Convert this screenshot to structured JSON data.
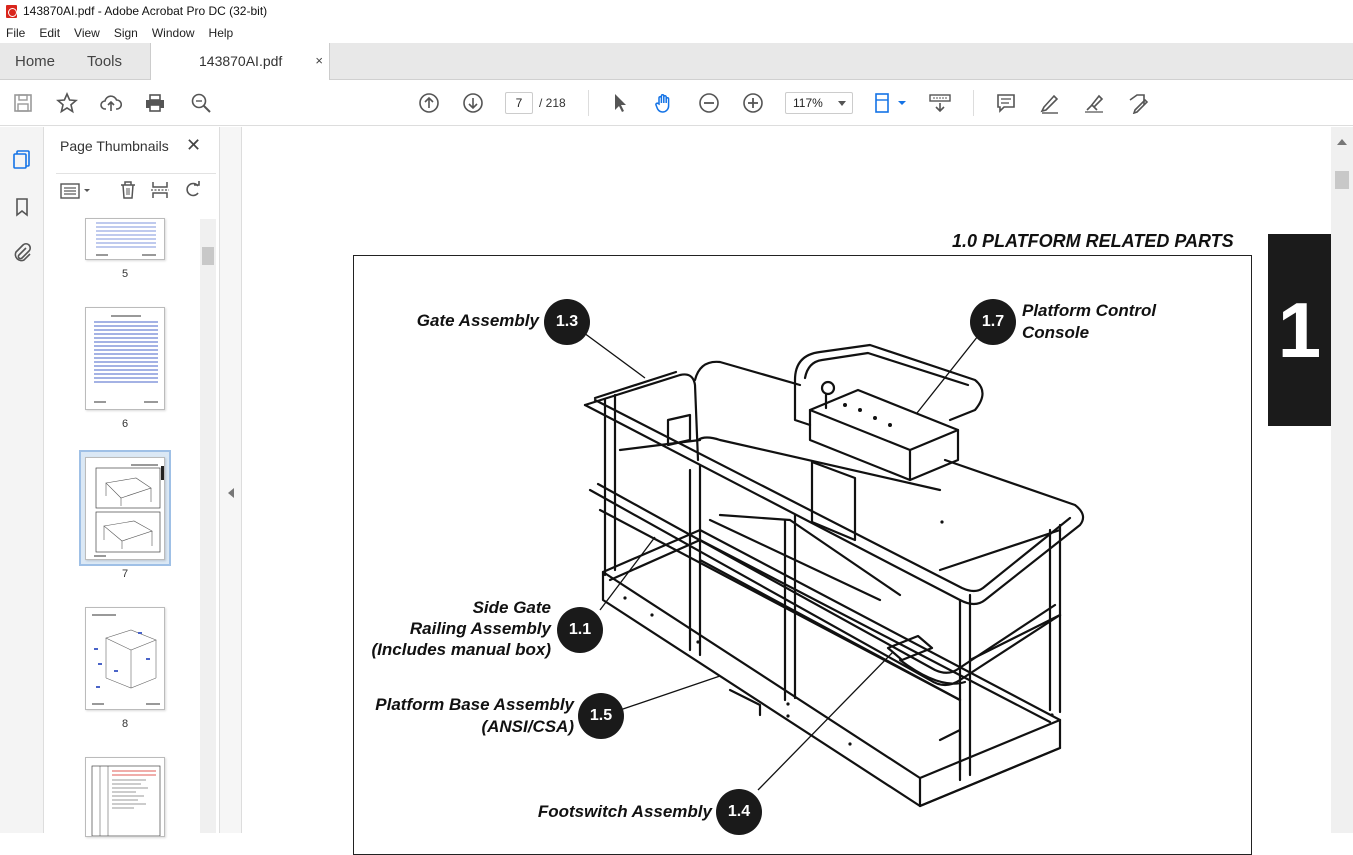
{
  "window": {
    "title": "143870AI.pdf - Adobe Acrobat Pro DC (32-bit)"
  },
  "menu": [
    "File",
    "Edit",
    "View",
    "Sign",
    "Window",
    "Help"
  ],
  "tabs": {
    "home": "Home",
    "tools": "Tools",
    "document": "143870AI.pdf",
    "close": "×"
  },
  "toolbar": {
    "current_page": "7",
    "page_total": "/ 218",
    "zoom": "117%"
  },
  "panel": {
    "title": "Page Thumbnails",
    "close": "✕"
  },
  "thumbnails": [
    {
      "number": "5"
    },
    {
      "number": "6"
    },
    {
      "number": "7",
      "selected": true
    },
    {
      "number": "8"
    }
  ],
  "page": {
    "section_heading": "1.0  PLATFORM RELATED PARTS",
    "chapter_tab": "1",
    "callouts": {
      "gate": {
        "label": "Gate Assembly",
        "number": "1.3"
      },
      "console": {
        "label_line1": "Platform Control",
        "label_line2": "Console",
        "number": "1.7"
      },
      "side_gate": {
        "label_line1": "Side Gate",
        "label_line2": "Railing Assembly",
        "label_line3": "(Includes manual box)",
        "number": "1.1"
      },
      "base": {
        "label_line1": "Platform Base Assembly",
        "label_line2": "(ANSI/CSA)",
        "number": "1.5"
      },
      "footswitch": {
        "label": "Footswitch Assembly",
        "number": "1.4"
      }
    }
  },
  "colors": {
    "accent_blue": "#1473e6",
    "pdf_red": "#d9251c",
    "chapter_tab": "#1b1b1b"
  }
}
